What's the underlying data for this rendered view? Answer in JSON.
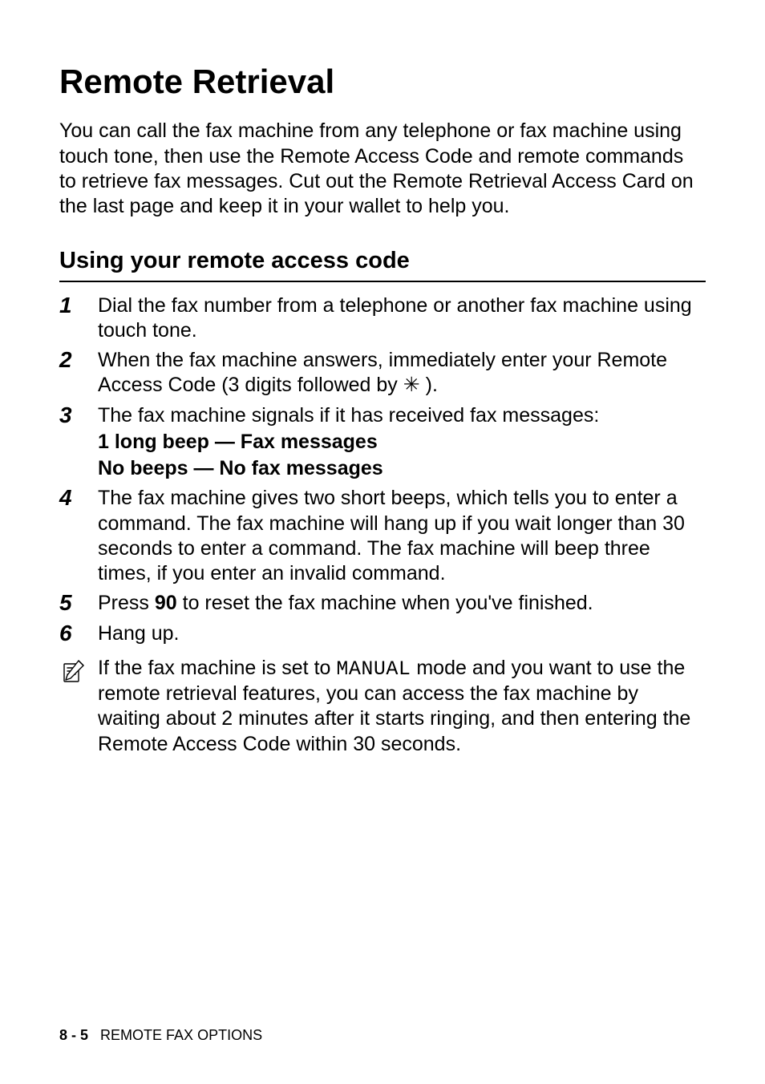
{
  "title": "Remote Retrieval",
  "intro": "You can call the fax machine from any telephone or fax machine using touch tone, then use the Remote Access Code and remote commands to retrieve fax messages. Cut out the Remote Retrieval Access Card on the last page and keep it in your wallet to help you.",
  "subheading": "Using your remote access code",
  "steps": {
    "s1": {
      "num": "1",
      "text": "Dial the fax number from a telephone or another fax machine using touch tone."
    },
    "s2": {
      "num": "2",
      "pre": "When the fax machine answers, immediately enter your Remote Access Code (3 digits followed by ",
      "star": "✳",
      "post": " )."
    },
    "s3": {
      "num": "3",
      "text": "The fax machine signals if it has received fax messages:",
      "sub1": "1 long beep — Fax messages",
      "sub2": "No beeps — No fax messages"
    },
    "s4": {
      "num": "4",
      "text": "The fax machine gives two short beeps, which tells you to enter a command. The fax machine will hang up if you wait longer than 30 seconds to enter a command. The fax machine will beep three times, if you enter an invalid command."
    },
    "s5": {
      "num": "5",
      "pre": "Press ",
      "code": "90",
      "post": " to reset the fax machine when you've finished."
    },
    "s6": {
      "num": "6",
      "text": "Hang up."
    }
  },
  "note": {
    "pre": "If the fax machine is set to ",
    "mode": "MANUAL",
    "post": " mode and you want to use the remote retrieval features, you can access the fax machine by waiting about 2 minutes after it starts ringing, and then entering the Remote Access Code within 30 seconds."
  },
  "footer": {
    "page": "8 - 5",
    "section": "REMOTE FAX OPTIONS"
  }
}
